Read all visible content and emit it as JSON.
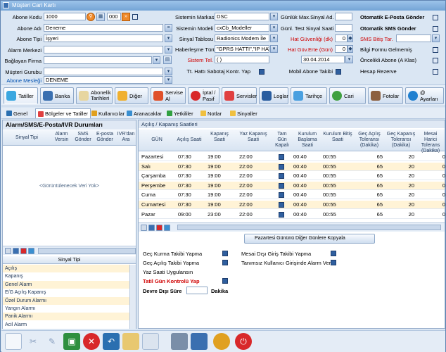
{
  "window": {
    "title": "Müşteri Cari Kartı"
  },
  "form": {
    "abone_kodu": {
      "label": "Abone Kodu",
      "value": "1000",
      "extra_value": "000"
    },
    "abone_adi": {
      "label": "Abone Adı",
      "value": "Deneme"
    },
    "abone_tipi": {
      "label": "Abone Tipi",
      "value": "İşyeri"
    },
    "alarm_merkezi": {
      "label": "Alarm Merkezi",
      "value": ""
    },
    "baglayan_firma": {
      "label": "Bağlayan Firma",
      "value": ""
    },
    "musteri_gurubu": {
      "label": "Müşteri Gurubu",
      "value": ""
    },
    "abone_meslegi": {
      "label": "Abone Mesleği",
      "value": "DENEME"
    },
    "sistemin_markasi": {
      "label": "Sistemin Markası",
      "value": "DSC"
    },
    "sistemin_modeli": {
      "label": "Sistemin Modeli",
      "value": "cxCb_Modeller"
    },
    "sinyal_tablosu": {
      "label": "Sinyal Tablosu",
      "value": "Radionics Modem İle"
    },
    "haberlesme_turu": {
      "label": "Haberleşme Türü",
      "value": "\"GPRS HATTI\",\"IP HATTI\""
    },
    "sistem_tel": {
      "label": "Sistem Tel.",
      "value": "(  )"
    },
    "tt_hatti": {
      "label": "Tt. Hattı Sabotaj Kontr. Yap"
    },
    "gunluk_max": {
      "label": "Günlük Max.Sinyal Ad.",
      "value": ""
    },
    "gunl_test": {
      "label": "Günl. Test Sinyal Saati",
      "value": ""
    },
    "hat_guvenligi": {
      "label": "Hat Güvenliği (dk)",
      "value": "0"
    },
    "hat_guv_erte": {
      "label": "Hat Güv.Erte (Gün)",
      "value": "0"
    },
    "tarih": {
      "value": "30.04.2014"
    },
    "mobil": {
      "label": "Mobil Abone Takibi"
    },
    "oto_eposta": {
      "label": "Otomatik E-Posta Gönder"
    },
    "oto_sms": {
      "label": "Otomatik SMS Gönder"
    },
    "sms_bitis": {
      "label": "SMS Bitiş Tar.",
      "value": ""
    },
    "bilgi_formu": {
      "label": "Bilgi Formu Gelmemiş"
    },
    "oncelikli": {
      "label": "Öncelikli Abone (A Klas)"
    },
    "hesap_rezerve": {
      "label": "Hesap Rezerve"
    }
  },
  "main_tabs": [
    "Tatiller",
    "Banka",
    "Abonelik Tarihleri",
    "Diğer",
    "Servise Al",
    "İptal / Pasif",
    "Servisler",
    "Loglar",
    "Tarihçe",
    "Cari",
    "Fotolar",
    "@ Ayarları"
  ],
  "sub_tabs": [
    "Genel",
    "Bölgeler ve Tatiller",
    "Kullanıcılar",
    "Aranacaklar",
    "Yetkililer",
    "Notlar",
    "Sinyaller"
  ],
  "left_panel": {
    "title": "Alarm/SMS/E-Posta/IVR Durumları",
    "columns": [
      "Sinyal Tipi",
      "Alarm Versin",
      "SMS Gönder",
      "E-posta Gönder",
      "IVR'dan Ara"
    ],
    "empty_text": "<Görüntülenecek Veri Yok>",
    "sinyal_header": "Sinyal Tipi",
    "sinyal_rows": [
      "Açılış",
      "Kapanış",
      "Genel Alarm",
      "E/G Açılış Kapanış",
      "Özel Durum Alarmı",
      "Yangın Alarmı",
      "Panik Alarmı",
      "Acil Alarm"
    ]
  },
  "right_panel": {
    "title": "Açılış / Kapanış Saatleri",
    "columns": [
      "GÜN",
      "Açılış Saati",
      "Kapanış Saati",
      "Yaz Kapanış Saati",
      "Tam Gün Kapalı",
      "Kurulum Başlama Saati",
      "Kurulum Bitiş Saati",
      "Geç Açılış Toleransı (Dakika)",
      "Geç Kapanış Toleransı (Dakika)",
      "Mesai Harici Tolerans (Dakika)"
    ],
    "rows": [
      [
        "Pazartesi",
        "07:30",
        "19:00",
        "22:00",
        "00:40",
        "00:55",
        "65",
        "20",
        "0"
      ],
      [
        "Salı",
        "07:30",
        "19:00",
        "22:00",
        "00:40",
        "00:55",
        "65",
        "20",
        "0"
      ],
      [
        "Çarşamba",
        "07:30",
        "19:00",
        "22:00",
        "00:40",
        "00:55",
        "65",
        "20",
        "0"
      ],
      [
        "Perşembe",
        "07:30",
        "19:00",
        "22:00",
        "00:40",
        "00:55",
        "65",
        "20",
        "0"
      ],
      [
        "Cuma",
        "07:30",
        "19:00",
        "22:00",
        "00:40",
        "00:55",
        "65",
        "20",
        "0"
      ],
      [
        "Cumartesi",
        "07:30",
        "19:00",
        "22:00",
        "00:40",
        "00:55",
        "65",
        "20",
        "0"
      ],
      [
        "Pazar",
        "09:00",
        "23:00",
        "22:00",
        "00:40",
        "00:55",
        "65",
        "20",
        "0"
      ]
    ],
    "copy_button": "Pazartesi Gününü Diğer Günlere Kopyala",
    "options_left": [
      "Geç Kurma Takibi Yapma",
      "Geç Açılış Takibi Yapma",
      "Yaz Saati Uygulansın",
      "Tatil Gün Kontrolü Yap"
    ],
    "options_right": [
      "Mesai Dışı Giriş Takibi Yapma",
      "Tanımsız Kullanıcı Girişinde Alarm Ver"
    ],
    "devre_disi": {
      "label": "Devre Dışı Süre",
      "value": "",
      "unit": "Dakika"
    }
  },
  "colors": {
    "accent": "#2f5f9f",
    "red_label": "#d00000",
    "alt_row": "#fff3d6"
  }
}
